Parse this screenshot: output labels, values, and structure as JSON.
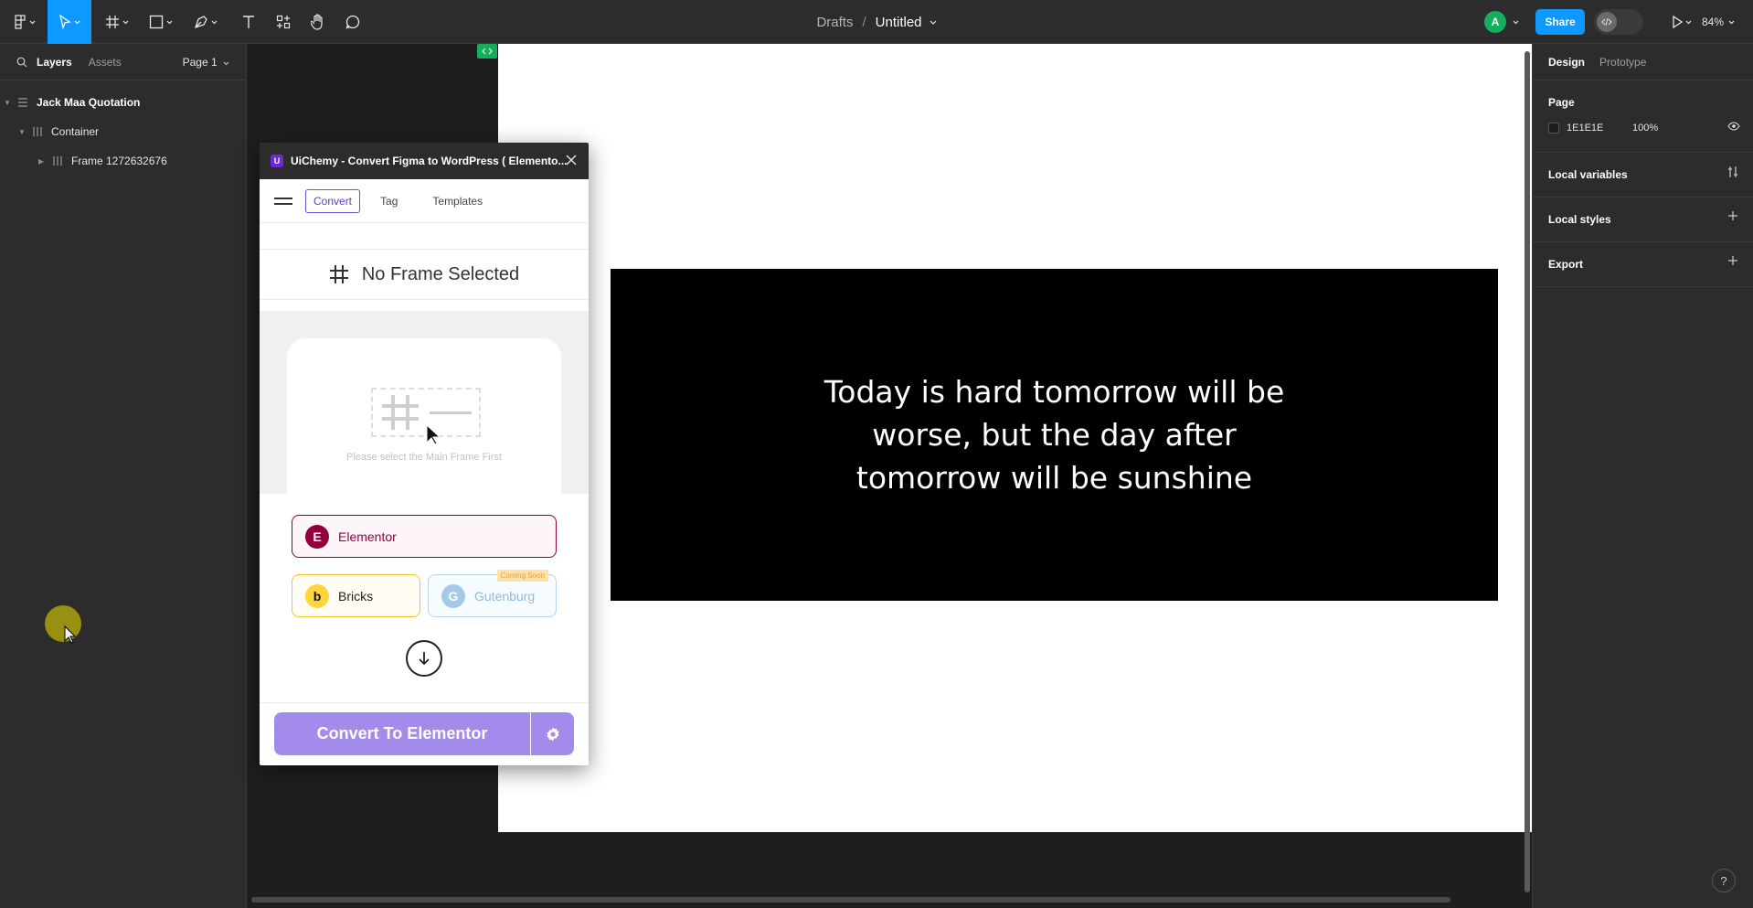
{
  "toolbar": {
    "breadcrumb_drafts": "Drafts",
    "breadcrumb_sep": "/",
    "file_title": "Untitled",
    "avatar_initial": "A",
    "share_label": "Share",
    "zoom_label": "84%"
  },
  "layers_panel": {
    "tab_layers": "Layers",
    "tab_assets": "Assets",
    "page_selector": "Page 1",
    "items": [
      {
        "label": "Jack Maa Quotation"
      },
      {
        "label": "Container"
      },
      {
        "label": "Frame 1272632676"
      }
    ]
  },
  "design_panel": {
    "tab_design": "Design",
    "tab_prototype": "Prototype",
    "page_heading": "Page",
    "page_color_hex": "1E1E1E",
    "page_opacity": "100%",
    "local_variables": "Local variables",
    "local_styles": "Local styles",
    "export": "Export"
  },
  "canvas": {
    "quote_text": "Today is hard tomorrow will be worse, but the day after tomorrow will be sunshine",
    "quote_bg_color": "#000000",
    "frame_bg_color": "#ffffff"
  },
  "plugin": {
    "title": "UiChemy - Convert Figma to WordPress ( Elemento...",
    "tabs": [
      "Convert",
      "Tag",
      "Templates"
    ],
    "no_frame_text": "No Frame Selected",
    "placeholder_text": "Please select the Main Frame First",
    "builders": {
      "elementor": "Elementor",
      "bricks": "Bricks",
      "gutenburg": "Gutenburg",
      "coming_soon": "Coming Soon"
    },
    "convert_button": "Convert To Elementor",
    "accent_color": "#a38bec"
  },
  "help_label": "?"
}
